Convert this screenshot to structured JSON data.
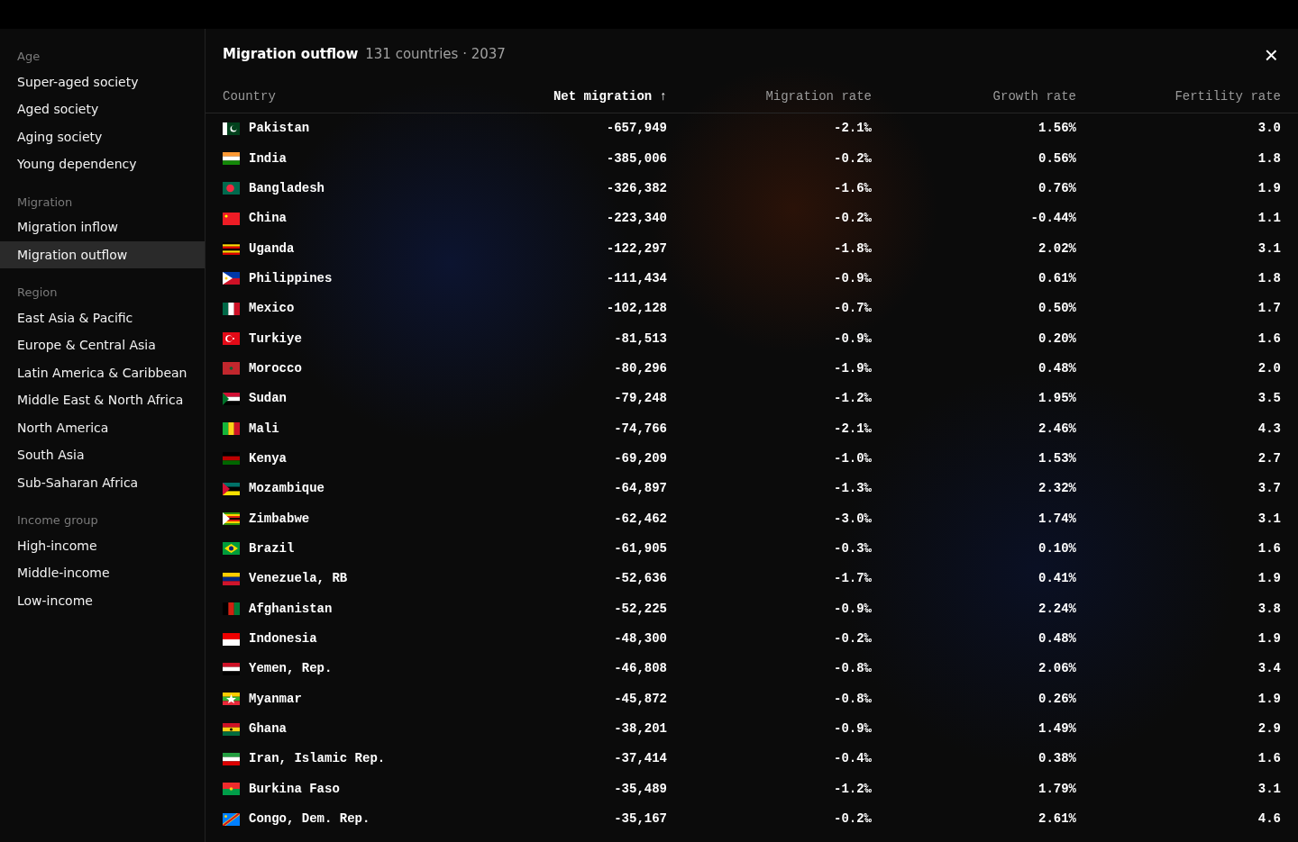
{
  "sidebar": {
    "groups": [
      {
        "heading": "Age",
        "items": [
          {
            "label": "Super-aged society",
            "selected": false
          },
          {
            "label": "Aged society",
            "selected": false
          },
          {
            "label": "Aging society",
            "selected": false
          },
          {
            "label": "Young dependency",
            "selected": false
          }
        ]
      },
      {
        "heading": "Migration",
        "items": [
          {
            "label": "Migration inflow",
            "selected": false
          },
          {
            "label": "Migration outflow",
            "selected": true
          }
        ]
      },
      {
        "heading": "Region",
        "items": [
          {
            "label": "East Asia & Pacific",
            "selected": false
          },
          {
            "label": "Europe & Central Asia",
            "selected": false
          },
          {
            "label": "Latin America & Caribbean",
            "selected": false
          },
          {
            "label": "Middle East & North Africa",
            "selected": false
          },
          {
            "label": "North America",
            "selected": false
          },
          {
            "label": "South Asia",
            "selected": false
          },
          {
            "label": "Sub-Saharan Africa",
            "selected": false
          }
        ]
      },
      {
        "heading": "Income group",
        "items": [
          {
            "label": "High-income",
            "selected": false
          },
          {
            "label": "Middle-income",
            "selected": false
          },
          {
            "label": "Low-income",
            "selected": false
          }
        ]
      }
    ]
  },
  "panel": {
    "title": "Migration outflow",
    "subtitle": "131 countries · 2037",
    "close": "×"
  },
  "table": {
    "columns": [
      {
        "label": "Country",
        "sorted": false
      },
      {
        "label": "Net migration",
        "sorted": true,
        "sort_arrow": "↑"
      },
      {
        "label": "Migration rate",
        "sorted": false
      },
      {
        "label": "Growth rate",
        "sorted": false
      },
      {
        "label": "Fertility rate",
        "sorted": false
      }
    ],
    "rows": [
      [
        "Pakistan",
        "-657,949",
        "-2.1‰",
        "1.56%",
        "3.0"
      ],
      [
        "India",
        "-385,006",
        "-0.2‰",
        "0.56%",
        "1.8"
      ],
      [
        "Bangladesh",
        "-326,382",
        "-1.6‰",
        "0.76%",
        "1.9"
      ],
      [
        "China",
        "-223,340",
        "-0.2‰",
        "-0.44%",
        "1.1"
      ],
      [
        "Uganda",
        "-122,297",
        "-1.8‰",
        "2.02%",
        "3.1"
      ],
      [
        "Philippines",
        "-111,434",
        "-0.9‰",
        "0.61%",
        "1.8"
      ],
      [
        "Mexico",
        "-102,128",
        "-0.7‰",
        "0.50%",
        "1.7"
      ],
      [
        "Turkiye",
        "-81,513",
        "-0.9‰",
        "0.20%",
        "1.6"
      ],
      [
        "Morocco",
        "-80,296",
        "-1.9‰",
        "0.48%",
        "2.0"
      ],
      [
        "Sudan",
        "-79,248",
        "-1.2‰",
        "1.95%",
        "3.5"
      ],
      [
        "Mali",
        "-74,766",
        "-2.1‰",
        "2.46%",
        "4.3"
      ],
      [
        "Kenya",
        "-69,209",
        "-1.0‰",
        "1.53%",
        "2.7"
      ],
      [
        "Mozambique",
        "-64,897",
        "-1.3‰",
        "2.32%",
        "3.7"
      ],
      [
        "Zimbabwe",
        "-62,462",
        "-3.0‰",
        "1.74%",
        "3.1"
      ],
      [
        "Brazil",
        "-61,905",
        "-0.3‰",
        "0.10%",
        "1.6"
      ],
      [
        "Venezuela, RB",
        "-52,636",
        "-1.7‰",
        "0.41%",
        "1.9"
      ],
      [
        "Afghanistan",
        "-52,225",
        "-0.9‰",
        "2.24%",
        "3.8"
      ],
      [
        "Indonesia",
        "-48,300",
        "-0.2‰",
        "0.48%",
        "1.9"
      ],
      [
        "Yemen, Rep.",
        "-46,808",
        "-0.8‰",
        "2.06%",
        "3.4"
      ],
      [
        "Myanmar",
        "-45,872",
        "-0.8‰",
        "0.26%",
        "1.9"
      ],
      [
        "Ghana",
        "-38,201",
        "-0.9‰",
        "1.49%",
        "2.9"
      ],
      [
        "Iran, Islamic Rep.",
        "-37,414",
        "-0.4‰",
        "0.38%",
        "1.6"
      ],
      [
        "Burkina Faso",
        "-35,489",
        "-1.2‰",
        "1.79%",
        "3.1"
      ],
      [
        "Congo, Dem. Rep.",
        "-35,167",
        "-0.2‰",
        "2.61%",
        "4.6"
      ]
    ]
  }
}
